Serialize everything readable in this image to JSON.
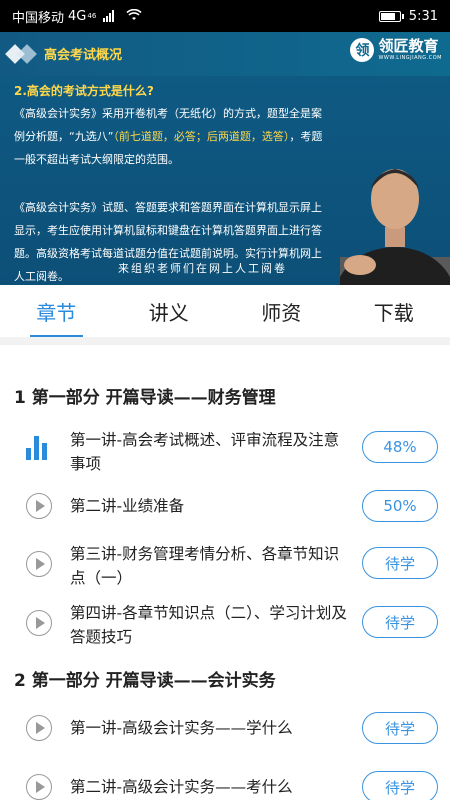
{
  "status_bar": {
    "carrier": "中国移动",
    "network": "4G",
    "network_sup": "46",
    "time": "5:31"
  },
  "video": {
    "slide_title": "高会考试概况",
    "logo_mark": "领",
    "logo_name": "领匠教育",
    "logo_url": "WWW.LINGJIANG.COM",
    "question": "2.高会的考试方式是什么?",
    "para1_a": "《高级会计实务》采用开卷机考（无纸化）的方式，题型全是案例分析题，“九选八”",
    "para1_hl": "（前七道题，必答；后两道题，选答）",
    "para1_b": "，考题一般不超出考试大纲限定的范围。",
    "para2": "《高级会计实务》试题、答题要求和答题界面在计算机显示屏上显示，考生应使用计算机鼠标和键盘在计算机答题界面上进行答题。高级资格考试每道试题分值在试题前说明。实行计算机网上人工阅卷。",
    "subtitle": "来组织老师们在网上人工阅卷"
  },
  "tabs": [
    {
      "label": "章节",
      "active": true
    },
    {
      "label": "讲义",
      "active": false
    },
    {
      "label": "师资",
      "active": false
    },
    {
      "label": "下载",
      "active": false
    }
  ],
  "sections": [
    {
      "title": "1 第一部分 开篇导读——财务管理"
    },
    {
      "title": "2 第一部分 开篇导读——会计实务"
    }
  ],
  "lessons": [
    {
      "title": "第一讲-高会考试概述、评审流程及注意事项",
      "status": "48%",
      "icon": "bar-chart-icon"
    },
    {
      "title": "第二讲-业绩准备",
      "status": "50%",
      "icon": "play-icon"
    },
    {
      "title": "第三讲-财务管理考情分析、各章节知识点（一）",
      "status": "待学",
      "icon": "play-icon"
    },
    {
      "title": "第四讲-各章节知识点（二）、学习计划及答题技巧",
      "status": "待学",
      "icon": "play-icon"
    },
    {
      "title": "第一讲-高级会计实务——学什么",
      "status": "待学",
      "icon": "play-icon"
    },
    {
      "title": "第二讲-高级会计实务——考什么",
      "status": "待学",
      "icon": "play-icon"
    }
  ],
  "colors": {
    "accent": "#2a8bdc",
    "slide_bg": "#0e5c86",
    "highlight": "#ffd84a"
  }
}
